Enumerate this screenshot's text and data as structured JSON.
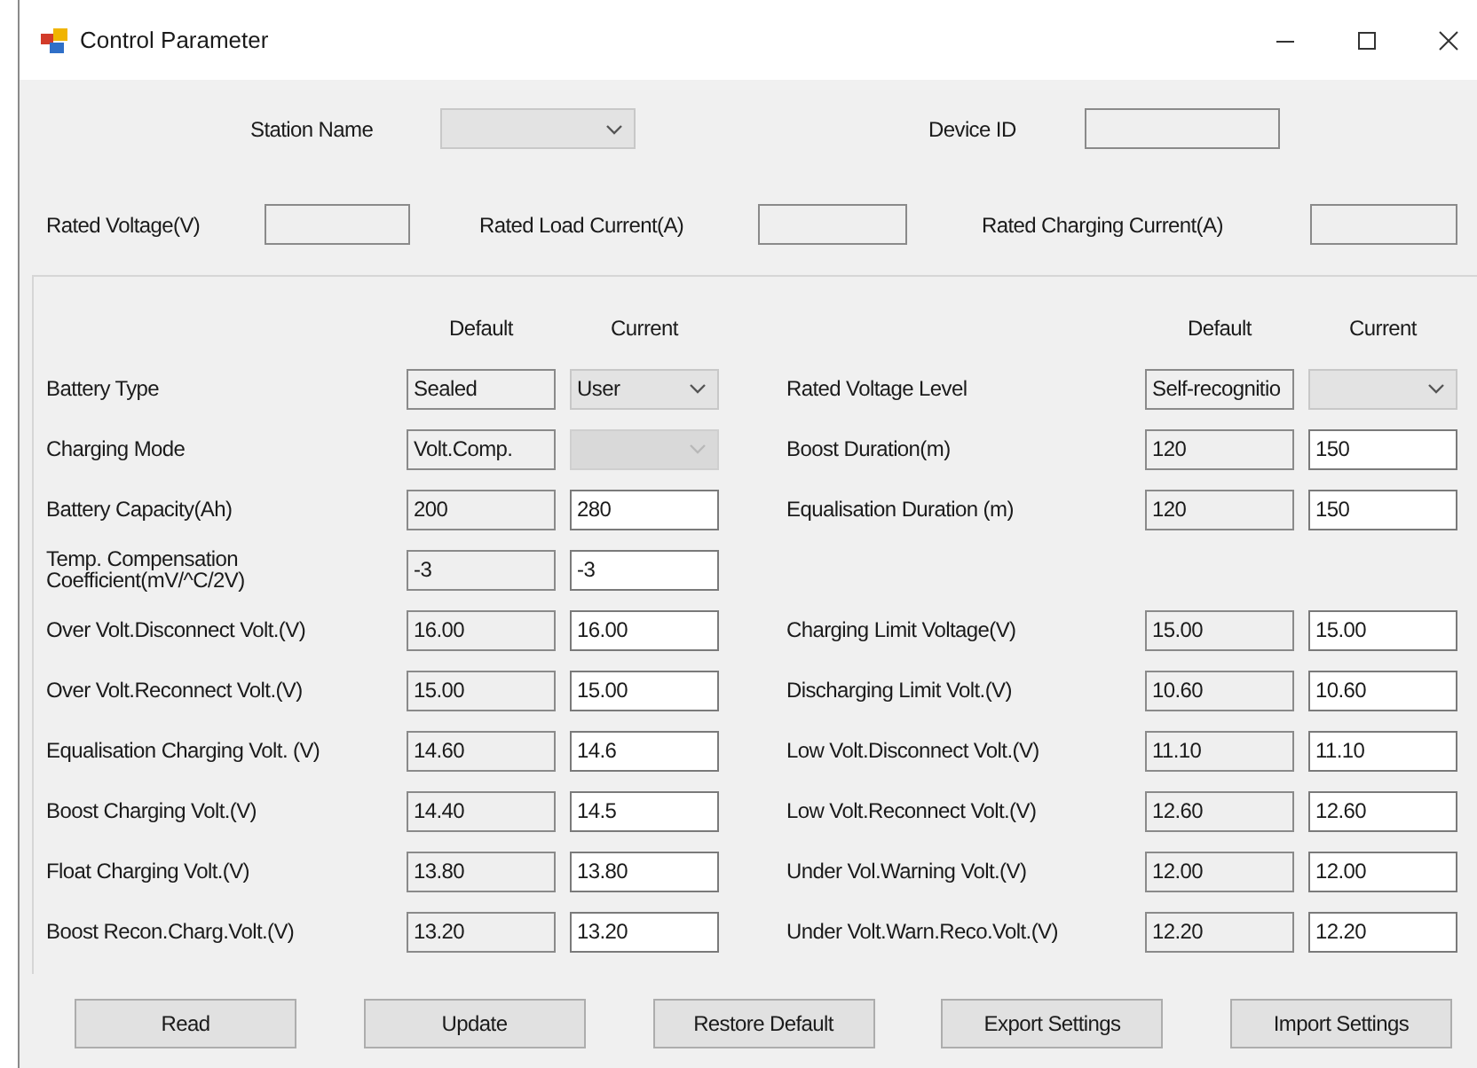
{
  "window": {
    "title": "Control Parameter"
  },
  "header": {
    "rows": [
      [
        {
          "label": "Station Name",
          "field": {
            "kind": "combo",
            "disabled": false
          }
        },
        {
          "label": "Device ID",
          "field": {
            "kind": "text",
            "readonly": true
          }
        }
      ],
      [
        {
          "label": "Rated Voltage(V)",
          "field": {
            "kind": "text",
            "readonly": true
          }
        },
        {
          "label": "Rated Load Current(A)",
          "field": {
            "kind": "text",
            "readonly": true
          }
        },
        {
          "label": "Rated Charging Current(A)",
          "field": {
            "kind": "text",
            "readonly": true
          }
        }
      ]
    ]
  },
  "parameters": {
    "columns": [
      {
        "headers": [
          "Default",
          "Current"
        ],
        "rows": [
          {
            "kind": "param",
            "label": "Battery Type",
            "default": {
              "kind": "text",
              "value": "Sealed",
              "readonly": true
            },
            "current": {
              "kind": "combo",
              "value": "User",
              "disabled": false
            }
          },
          {
            "kind": "param",
            "label": "Charging Mode",
            "default": {
              "kind": "text",
              "value": "Volt.Comp.",
              "readonly": true
            },
            "current": {
              "kind": "combo",
              "disabled": true
            }
          },
          {
            "kind": "param",
            "label": "Battery Capacity(Ah)",
            "default": {
              "kind": "text",
              "value": "200",
              "readonly": true
            },
            "current": {
              "kind": "text",
              "value": "280",
              "readonly": false
            }
          },
          {
            "kind": "param",
            "label": "Temp. Compensation Coefficient(mV/^C/2V)",
            "default": {
              "kind": "text",
              "value": "-3",
              "readonly": true
            },
            "current": {
              "kind": "text",
              "value": "-3",
              "readonly": false
            }
          },
          {
            "kind": "param",
            "label": "Over Volt.Disconnect Volt.(V)",
            "default": {
              "kind": "text",
              "value": "16.00",
              "readonly": true
            },
            "current": {
              "kind": "text",
              "value": "16.00",
              "readonly": false
            }
          },
          {
            "kind": "param",
            "label": "Over Volt.Reconnect Volt.(V)",
            "default": {
              "kind": "text",
              "value": "15.00",
              "readonly": true
            },
            "current": {
              "kind": "text",
              "value": "15.00",
              "readonly": false
            }
          },
          {
            "kind": "param",
            "label": "Equalisation Charging Volt. (V)",
            "default": {
              "kind": "text",
              "value": "14.60",
              "readonly": true
            },
            "current": {
              "kind": "text",
              "value": "14.6",
              "readonly": false
            }
          },
          {
            "kind": "param",
            "label": "Boost Charging Volt.(V)",
            "default": {
              "kind": "text",
              "value": "14.40",
              "readonly": true
            },
            "current": {
              "kind": "text",
              "value": "14.5",
              "readonly": false
            }
          },
          {
            "kind": "param",
            "label": "Float Charging Volt.(V)",
            "default": {
              "kind": "text",
              "value": "13.80",
              "readonly": true
            },
            "current": {
              "kind": "text",
              "value": "13.80",
              "readonly": false
            }
          },
          {
            "kind": "param",
            "label": "Boost Recon.Charg.Volt.(V)",
            "default": {
              "kind": "text",
              "value": "13.20",
              "readonly": true
            },
            "current": {
              "kind": "text",
              "value": "13.20",
              "readonly": false
            }
          }
        ]
      },
      {
        "headers": [
          "Default",
          "Current"
        ],
        "rows": [
          {
            "kind": "param",
            "label": "Rated Voltage Level",
            "default": {
              "kind": "text",
              "value": "Self-recognitio",
              "readonly": true
            },
            "current": {
              "kind": "combo",
              "disabled": false
            }
          },
          {
            "kind": "param",
            "label": "Boost Duration(m)",
            "default": {
              "kind": "text",
              "value": "120",
              "readonly": true
            },
            "current": {
              "kind": "text",
              "value": "150",
              "readonly": false
            }
          },
          {
            "kind": "param",
            "label": "Equalisation Duration (m)",
            "default": {
              "kind": "text",
              "value": "120",
              "readonly": true
            },
            "current": {
              "kind": "text",
              "value": "150",
              "readonly": false
            }
          },
          {
            "kind": "gap"
          },
          {
            "kind": "param",
            "label": "Charging Limit Voltage(V)",
            "default": {
              "kind": "text",
              "value": "15.00",
              "readonly": true
            },
            "current": {
              "kind": "text",
              "value": "15.00",
              "readonly": false
            }
          },
          {
            "kind": "param",
            "label": "Discharging Limit Volt.(V)",
            "default": {
              "kind": "text",
              "value": "10.60",
              "readonly": true
            },
            "current": {
              "kind": "text",
              "value": "10.60",
              "readonly": false
            }
          },
          {
            "kind": "param",
            "label": "Low Volt.Disconnect Volt.(V)",
            "default": {
              "kind": "text",
              "value": "11.10",
              "readonly": true
            },
            "current": {
              "kind": "text",
              "value": "11.10",
              "readonly": false
            }
          },
          {
            "kind": "param",
            "label": "Low Volt.Reconnect Volt.(V)",
            "default": {
              "kind": "text",
              "value": "12.60",
              "readonly": true
            },
            "current": {
              "kind": "text",
              "value": "12.60",
              "readonly": false
            }
          },
          {
            "kind": "param",
            "label": "Under Vol.Warning Volt.(V)",
            "default": {
              "kind": "text",
              "value": "12.00",
              "readonly": true
            },
            "current": {
              "kind": "text",
              "value": "12.00",
              "readonly": false
            }
          },
          {
            "kind": "param",
            "label": "Under Volt.Warn.Reco.Volt.(V)",
            "default": {
              "kind": "text",
              "value": "12.20",
              "readonly": true
            },
            "current": {
              "kind": "text",
              "value": "12.20",
              "readonly": false
            }
          }
        ]
      }
    ]
  },
  "buttons": [
    "Read",
    "Update",
    "Restore Default",
    "Export Settings",
    "Import Settings"
  ]
}
